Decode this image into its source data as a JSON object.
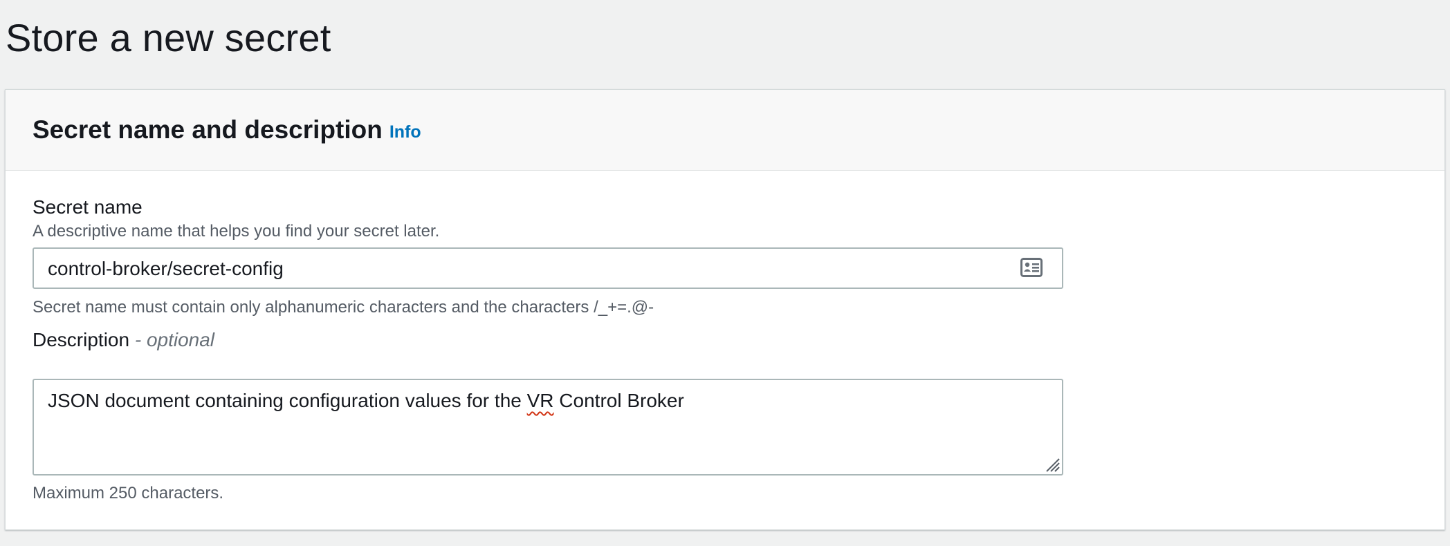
{
  "page": {
    "title": "Store a new secret"
  },
  "panel": {
    "title": "Secret name and description",
    "info_label": "Info"
  },
  "secret_name": {
    "label": "Secret name",
    "description": "A descriptive name that helps you find your secret later.",
    "value": "control-broker/secret-config",
    "constraint": "Secret name must contain only alphanumeric characters and the characters /_+=.@-",
    "icon": "contact-card-icon"
  },
  "description_field": {
    "label": "Description",
    "optional_suffix": "- optional",
    "value_before": "JSON document containing configuration values for the ",
    "value_flagged": "VR",
    "value_after": " Control Broker",
    "constraint": "Maximum 250 characters."
  },
  "colors": {
    "link": "#0073bb",
    "page_background": "#f0f1f1",
    "spellcheck": "#d13212"
  }
}
